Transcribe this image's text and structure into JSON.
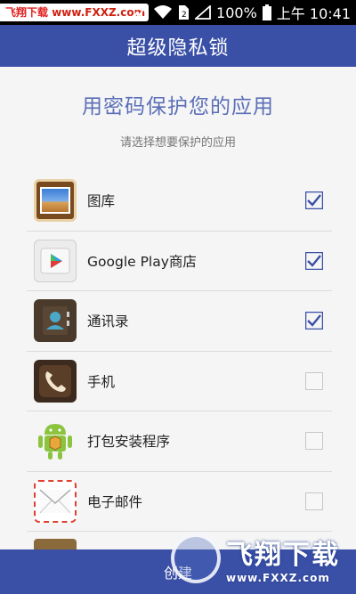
{
  "status_bar": {
    "watermark_text": "飞翔下载",
    "watermark_url": "www.FXXZ.com",
    "battery": "100%",
    "time": "上午 10:41"
  },
  "title": "超级隐私锁",
  "heading": "用密码保护您的应用",
  "subheading": "请选择想要保护的应用",
  "apps": [
    {
      "label": "图库",
      "icon": "gallery-icon",
      "checked": true
    },
    {
      "label": "Google Play商店",
      "icon": "play-store-icon",
      "checked": true
    },
    {
      "label": "通讯录",
      "icon": "contacts-icon",
      "checked": true
    },
    {
      "label": "手机",
      "icon": "phone-icon",
      "checked": false
    },
    {
      "label": "打包安装程序",
      "icon": "package-installer-icon",
      "checked": false
    },
    {
      "label": "电子邮件",
      "icon": "email-icon",
      "checked": false
    }
  ],
  "bottom_button": "创建",
  "logo_watermark": {
    "cn": "飞翔下载",
    "url": "www.FXXZ.com"
  },
  "colors": {
    "primary": "#3a4fa6",
    "heading": "#5b6fb8",
    "check": "#3a4fa6"
  }
}
